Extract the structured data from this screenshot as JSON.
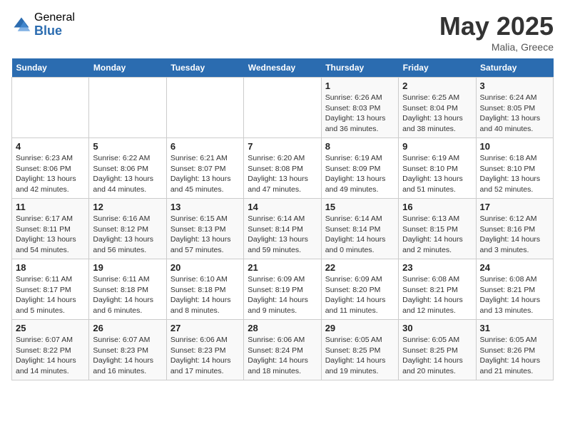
{
  "header": {
    "logo_general": "General",
    "logo_blue": "Blue",
    "month_title": "May 2025",
    "location": "Malia, Greece"
  },
  "days_of_week": [
    "Sunday",
    "Monday",
    "Tuesday",
    "Wednesday",
    "Thursday",
    "Friday",
    "Saturday"
  ],
  "weeks": [
    [
      {
        "day": "",
        "info": ""
      },
      {
        "day": "",
        "info": ""
      },
      {
        "day": "",
        "info": ""
      },
      {
        "day": "",
        "info": ""
      },
      {
        "day": "1",
        "info": "Sunrise: 6:26 AM\nSunset: 8:03 PM\nDaylight: 13 hours\nand 36 minutes."
      },
      {
        "day": "2",
        "info": "Sunrise: 6:25 AM\nSunset: 8:04 PM\nDaylight: 13 hours\nand 38 minutes."
      },
      {
        "day": "3",
        "info": "Sunrise: 6:24 AM\nSunset: 8:05 PM\nDaylight: 13 hours\nand 40 minutes."
      }
    ],
    [
      {
        "day": "4",
        "info": "Sunrise: 6:23 AM\nSunset: 8:06 PM\nDaylight: 13 hours\nand 42 minutes."
      },
      {
        "day": "5",
        "info": "Sunrise: 6:22 AM\nSunset: 8:06 PM\nDaylight: 13 hours\nand 44 minutes."
      },
      {
        "day": "6",
        "info": "Sunrise: 6:21 AM\nSunset: 8:07 PM\nDaylight: 13 hours\nand 45 minutes."
      },
      {
        "day": "7",
        "info": "Sunrise: 6:20 AM\nSunset: 8:08 PM\nDaylight: 13 hours\nand 47 minutes."
      },
      {
        "day": "8",
        "info": "Sunrise: 6:19 AM\nSunset: 8:09 PM\nDaylight: 13 hours\nand 49 minutes."
      },
      {
        "day": "9",
        "info": "Sunrise: 6:19 AM\nSunset: 8:10 PM\nDaylight: 13 hours\nand 51 minutes."
      },
      {
        "day": "10",
        "info": "Sunrise: 6:18 AM\nSunset: 8:10 PM\nDaylight: 13 hours\nand 52 minutes."
      }
    ],
    [
      {
        "day": "11",
        "info": "Sunrise: 6:17 AM\nSunset: 8:11 PM\nDaylight: 13 hours\nand 54 minutes."
      },
      {
        "day": "12",
        "info": "Sunrise: 6:16 AM\nSunset: 8:12 PM\nDaylight: 13 hours\nand 56 minutes."
      },
      {
        "day": "13",
        "info": "Sunrise: 6:15 AM\nSunset: 8:13 PM\nDaylight: 13 hours\nand 57 minutes."
      },
      {
        "day": "14",
        "info": "Sunrise: 6:14 AM\nSunset: 8:14 PM\nDaylight: 13 hours\nand 59 minutes."
      },
      {
        "day": "15",
        "info": "Sunrise: 6:14 AM\nSunset: 8:14 PM\nDaylight: 14 hours\nand 0 minutes."
      },
      {
        "day": "16",
        "info": "Sunrise: 6:13 AM\nSunset: 8:15 PM\nDaylight: 14 hours\nand 2 minutes."
      },
      {
        "day": "17",
        "info": "Sunrise: 6:12 AM\nSunset: 8:16 PM\nDaylight: 14 hours\nand 3 minutes."
      }
    ],
    [
      {
        "day": "18",
        "info": "Sunrise: 6:11 AM\nSunset: 8:17 PM\nDaylight: 14 hours\nand 5 minutes."
      },
      {
        "day": "19",
        "info": "Sunrise: 6:11 AM\nSunset: 8:18 PM\nDaylight: 14 hours\nand 6 minutes."
      },
      {
        "day": "20",
        "info": "Sunrise: 6:10 AM\nSunset: 8:18 PM\nDaylight: 14 hours\nand 8 minutes."
      },
      {
        "day": "21",
        "info": "Sunrise: 6:09 AM\nSunset: 8:19 PM\nDaylight: 14 hours\nand 9 minutes."
      },
      {
        "day": "22",
        "info": "Sunrise: 6:09 AM\nSunset: 8:20 PM\nDaylight: 14 hours\nand 11 minutes."
      },
      {
        "day": "23",
        "info": "Sunrise: 6:08 AM\nSunset: 8:21 PM\nDaylight: 14 hours\nand 12 minutes."
      },
      {
        "day": "24",
        "info": "Sunrise: 6:08 AM\nSunset: 8:21 PM\nDaylight: 14 hours\nand 13 minutes."
      }
    ],
    [
      {
        "day": "25",
        "info": "Sunrise: 6:07 AM\nSunset: 8:22 PM\nDaylight: 14 hours\nand 14 minutes."
      },
      {
        "day": "26",
        "info": "Sunrise: 6:07 AM\nSunset: 8:23 PM\nDaylight: 14 hours\nand 16 minutes."
      },
      {
        "day": "27",
        "info": "Sunrise: 6:06 AM\nSunset: 8:23 PM\nDaylight: 14 hours\nand 17 minutes."
      },
      {
        "day": "28",
        "info": "Sunrise: 6:06 AM\nSunset: 8:24 PM\nDaylight: 14 hours\nand 18 minutes."
      },
      {
        "day": "29",
        "info": "Sunrise: 6:05 AM\nSunset: 8:25 PM\nDaylight: 14 hours\nand 19 minutes."
      },
      {
        "day": "30",
        "info": "Sunrise: 6:05 AM\nSunset: 8:25 PM\nDaylight: 14 hours\nand 20 minutes."
      },
      {
        "day": "31",
        "info": "Sunrise: 6:05 AM\nSunset: 8:26 PM\nDaylight: 14 hours\nand 21 minutes."
      }
    ]
  ]
}
